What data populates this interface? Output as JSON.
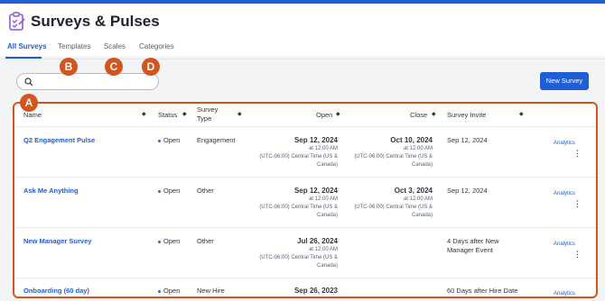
{
  "app": {
    "title": "Surveys & Pulses"
  },
  "tabs": [
    "All Surveys",
    "Templates",
    "Scales",
    "Categories"
  ],
  "search": {
    "placeholder": ""
  },
  "new_button": "New Survey",
  "callouts": [
    "A",
    "B",
    "C",
    "D"
  ],
  "columns": [
    "Name",
    "Status",
    "Survey Type",
    "Open",
    "Close",
    "Survey Invite"
  ],
  "rows": [
    {
      "name": "Q2 Engagement Pulse",
      "status": "Open",
      "type": "Engagement",
      "open_date": "Sep 12, 2024",
      "open_time": "at 12:00 AM",
      "open_tz1": "(UTC-06:00) Central Time (US &",
      "open_tz2": "Canada)",
      "close_date": "Oct 10, 2024",
      "close_time": "at 12:00 AM",
      "close_tz1": "(UTC-06:00) Central Time (US &",
      "close_tz2": "Canada)",
      "invite1": "Sep 12, 2024",
      "invite2": "",
      "analytics": "Analytics"
    },
    {
      "name": "Ask Me Anything",
      "status": "Open",
      "type": "Other",
      "open_date": "Sep 12, 2024",
      "open_time": "at 12:00 AM",
      "open_tz1": "(UTC-06:00) Central Time (US &",
      "open_tz2": "Canada)",
      "close_date": "Oct 3, 2024",
      "close_time": "at 12:00 AM",
      "close_tz1": "(UTC-06:00) Central Time (US &",
      "close_tz2": "Canada)",
      "invite1": "Sep 12, 2024",
      "invite2": "",
      "analytics": "Analytics"
    },
    {
      "name": "New Manager Survey",
      "status": "Open",
      "type": "Other",
      "open_date": "Jul 26, 2024",
      "open_time": "at 12:00 AM",
      "open_tz1": "(UTC-06:00) Central Time (US &",
      "open_tz2": "Canada)",
      "close_date": "",
      "close_time": "",
      "close_tz1": "",
      "close_tz2": "",
      "invite1": "4 Days after New",
      "invite2": "Manager Event",
      "analytics": "Analytics"
    },
    {
      "name": "Onboarding (60 day)",
      "status": "Open",
      "type": "New Hire",
      "open_date": "Sep 26, 2023",
      "open_time": "",
      "open_tz1": "",
      "open_tz2": "",
      "close_date": "",
      "close_time": "",
      "close_tz1": "",
      "close_tz2": "",
      "invite1": "60 Days after Hire Date",
      "invite2": "",
      "analytics": "Analytics"
    }
  ],
  "colors": {
    "accent": "#1f5fd6",
    "callout": "#d3541d"
  }
}
